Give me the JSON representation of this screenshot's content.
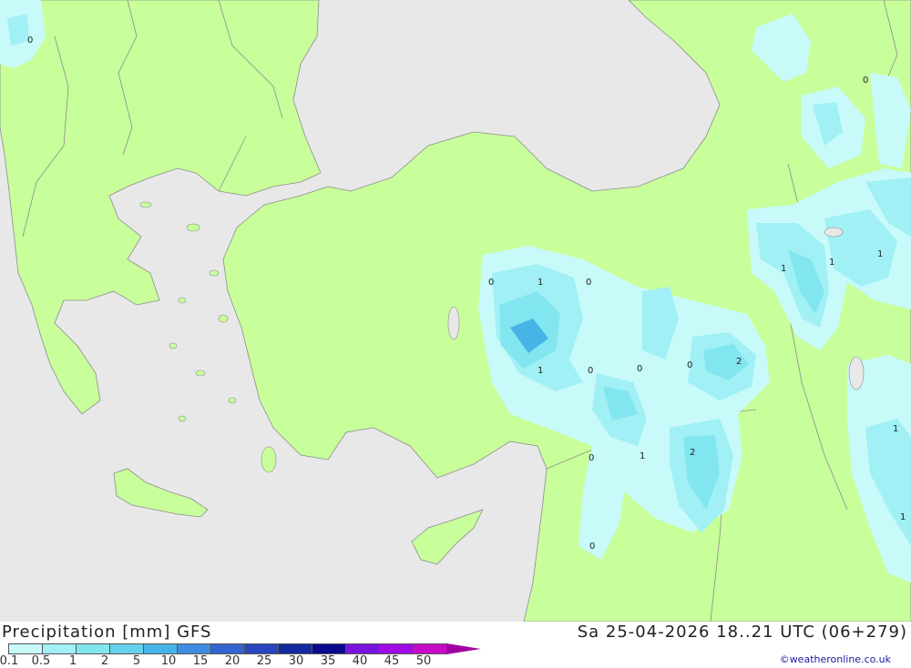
{
  "header": {
    "title": "Precipitation [mm] GFS",
    "datetime": "Sa 25-04-2026 18..21 UTC (06+279)",
    "credit": "©weatheronline.co.uk"
  },
  "legend": {
    "values": [
      "0.1",
      "0.5",
      "1",
      "2",
      "5",
      "10",
      "15",
      "20",
      "25",
      "30",
      "35",
      "40",
      "45",
      "50"
    ],
    "colors": [
      "#c8fafa",
      "#a0f0f5",
      "#82e6f0",
      "#64d2eb",
      "#46b4e6",
      "#3c8ce1",
      "#3264d2",
      "#2846be",
      "#1428a0",
      "#0a0a8c",
      "#7814dc",
      "#a00ae6",
      "#c80ac8",
      "#e600e6"
    ],
    "arrow_color": "#a000a0"
  },
  "map": {
    "sea_color": "#e8e8e8",
    "land_color": "#c8ff9b",
    "border_color": "#8c8c8c",
    "labels": [
      "0",
      "0",
      "0",
      "1",
      "0",
      "1",
      "0",
      "0",
      "0",
      "2",
      "0",
      "1",
      "2",
      "0",
      "1",
      "1",
      "1",
      "1",
      "1"
    ]
  }
}
